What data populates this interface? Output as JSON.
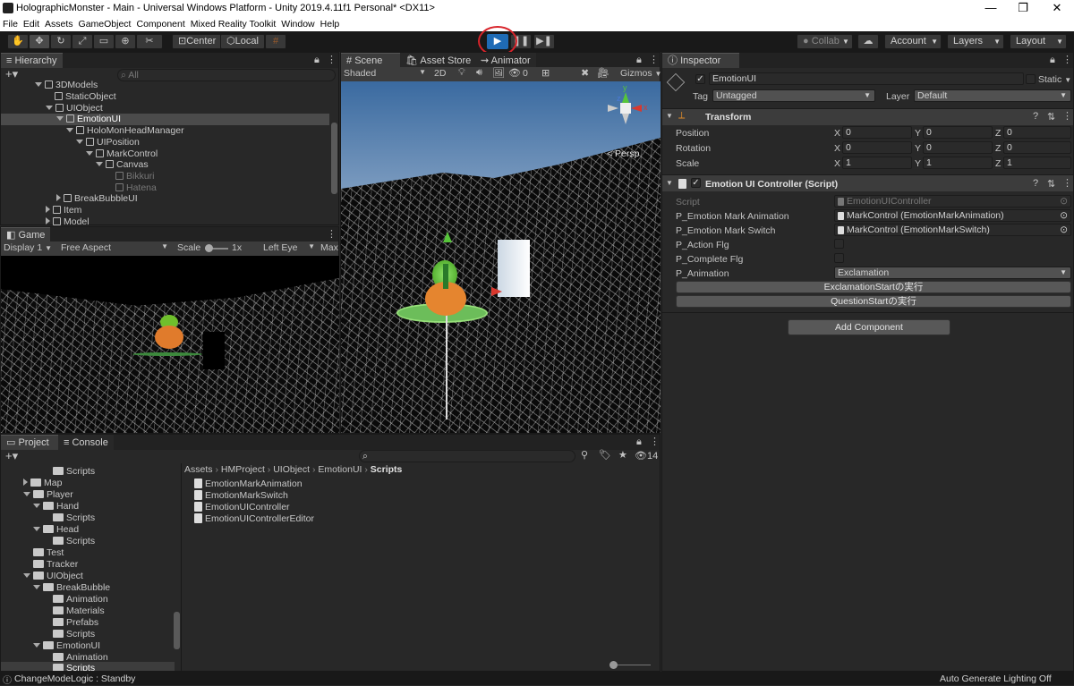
{
  "window": {
    "title": "HolographicMonster - Main - Universal Windows Platform - Unity 2019.4.11f1 Personal* <DX11>",
    "minimize": "—",
    "restore": "❐",
    "close": "✕"
  },
  "menu": [
    "File",
    "Edit",
    "Assets",
    "GameObject",
    "Component",
    "Mixed Reality Toolkit",
    "Window",
    "Help"
  ],
  "toolbar": {
    "center_label": "Center",
    "local_label": "Local",
    "collab_label": "Collab",
    "account_label": "Account",
    "layers_label": "Layers",
    "layout_label": "Layout",
    "play_state": "playing",
    "highlight_color": "#d8232a"
  },
  "hierarchy": {
    "tab": "Hierarchy",
    "search_placeholder": "All",
    "items": [
      {
        "label": "3DModels",
        "type": "go",
        "expanded": true
      },
      {
        "label": "StaticObject",
        "type": "go"
      },
      {
        "label": "UIObject",
        "type": "go",
        "expanded": true
      },
      {
        "label": "EmotionUI",
        "type": "go",
        "expanded": true,
        "selected": true
      },
      {
        "label": "HoloMonHeadManager",
        "type": "go",
        "expanded": true
      },
      {
        "label": "UIPosition",
        "type": "go",
        "expanded": true
      },
      {
        "label": "MarkControl",
        "type": "go",
        "expanded": true
      },
      {
        "label": "Canvas",
        "type": "go",
        "expanded": true
      },
      {
        "label": "Bikkuri",
        "type": "go",
        "disabled": true
      },
      {
        "label": "Hatena",
        "type": "go",
        "disabled": true
      },
      {
        "label": "BreakBubbleUI",
        "type": "go",
        "collapsed": true
      },
      {
        "label": "Item",
        "type": "go",
        "collapsed": true
      },
      {
        "label": "Model",
        "type": "go",
        "collapsed": true
      }
    ]
  },
  "game": {
    "tab": "Game",
    "display": "Display 1",
    "aspect": "Free Aspect",
    "scale_label": "Scale",
    "scale_value": "1x",
    "eye": "Left Eye",
    "max_label": "Max"
  },
  "scene": {
    "tabs": [
      "Scene",
      "Asset Store",
      "Animator"
    ],
    "shading": "Shaded",
    "mode_2d": "2D",
    "gizmos": "Gizmos",
    "hidden_count": "0",
    "gizmo_y": "y",
    "gizmo_x": "x",
    "gizmo_z": "z",
    "persp": "< Persp"
  },
  "project": {
    "tabs": [
      "Project",
      "Console"
    ],
    "hidden_count": "14",
    "breadcrumb": [
      "Assets",
      "HMProject",
      "UIObject",
      "EmotionUI",
      "Scripts"
    ],
    "tree": [
      {
        "label": "Scripts",
        "indent": 2
      },
      {
        "label": "Map",
        "indent": 1,
        "collapsed": true
      },
      {
        "label": "Player",
        "indent": 1,
        "expanded": true
      },
      {
        "label": "Hand",
        "indent": 2,
        "expanded": true
      },
      {
        "label": "Scripts",
        "indent": 3
      },
      {
        "label": "Head",
        "indent": 2,
        "expanded": true
      },
      {
        "label": "Scripts",
        "indent": 3
      },
      {
        "label": "Test",
        "indent": 1
      },
      {
        "label": "Tracker",
        "indent": 1
      },
      {
        "label": "UIObject",
        "indent": 1,
        "expanded": true
      },
      {
        "label": "BreakBubble",
        "indent": 2,
        "expanded": true
      },
      {
        "label": "Animation",
        "indent": 3
      },
      {
        "label": "Materials",
        "indent": 3
      },
      {
        "label": "Prefabs",
        "indent": 3
      },
      {
        "label": "Scripts",
        "indent": 3
      },
      {
        "label": "EmotionUI",
        "indent": 2,
        "expanded": true
      },
      {
        "label": "Animation",
        "indent": 3
      },
      {
        "label": "Scripts",
        "indent": 3,
        "selected": true
      }
    ],
    "files": [
      "EmotionMarkAnimation",
      "EmotionMarkSwitch",
      "EmotionUIController",
      "EmotionUIControllerEditor"
    ]
  },
  "inspector": {
    "tab": "Inspector",
    "object_name": "EmotionUI",
    "static_label": "Static",
    "tag_label": "Tag",
    "tag_value": "Untagged",
    "layer_label": "Layer",
    "layer_value": "Default",
    "transform": {
      "title": "Transform",
      "rows": [
        {
          "label": "Position",
          "x": "0",
          "y": "0",
          "z": "0"
        },
        {
          "label": "Rotation",
          "x": "0",
          "y": "0",
          "z": "0"
        },
        {
          "label": "Scale",
          "x": "1",
          "y": "1",
          "z": "1"
        }
      ]
    },
    "controller": {
      "title": "Emotion UI Controller (Script)",
      "script_label": "Script",
      "script_value": "EmotionUIController",
      "anim_label": "P_Emotion Mark Animation",
      "anim_value": "MarkControl (EmotionMarkAnimation)",
      "switch_label": "P_Emotion Mark Switch",
      "switch_value": "MarkControl (EmotionMarkSwitch)",
      "action_label": "P_Action Flg",
      "complete_label": "P_Complete Flg",
      "animation_label": "P_Animation",
      "animation_value": "Exclamation",
      "btn1": "ExclamationStartの実行",
      "btn2": "QuestionStartの実行"
    },
    "add_component": "Add Component"
  },
  "statusbar": {
    "message": "ChangeModeLogic : Standby",
    "right": "Auto Generate Lighting Off"
  },
  "axis_letters": {
    "x": "X",
    "y": "Y",
    "z": "Z"
  }
}
